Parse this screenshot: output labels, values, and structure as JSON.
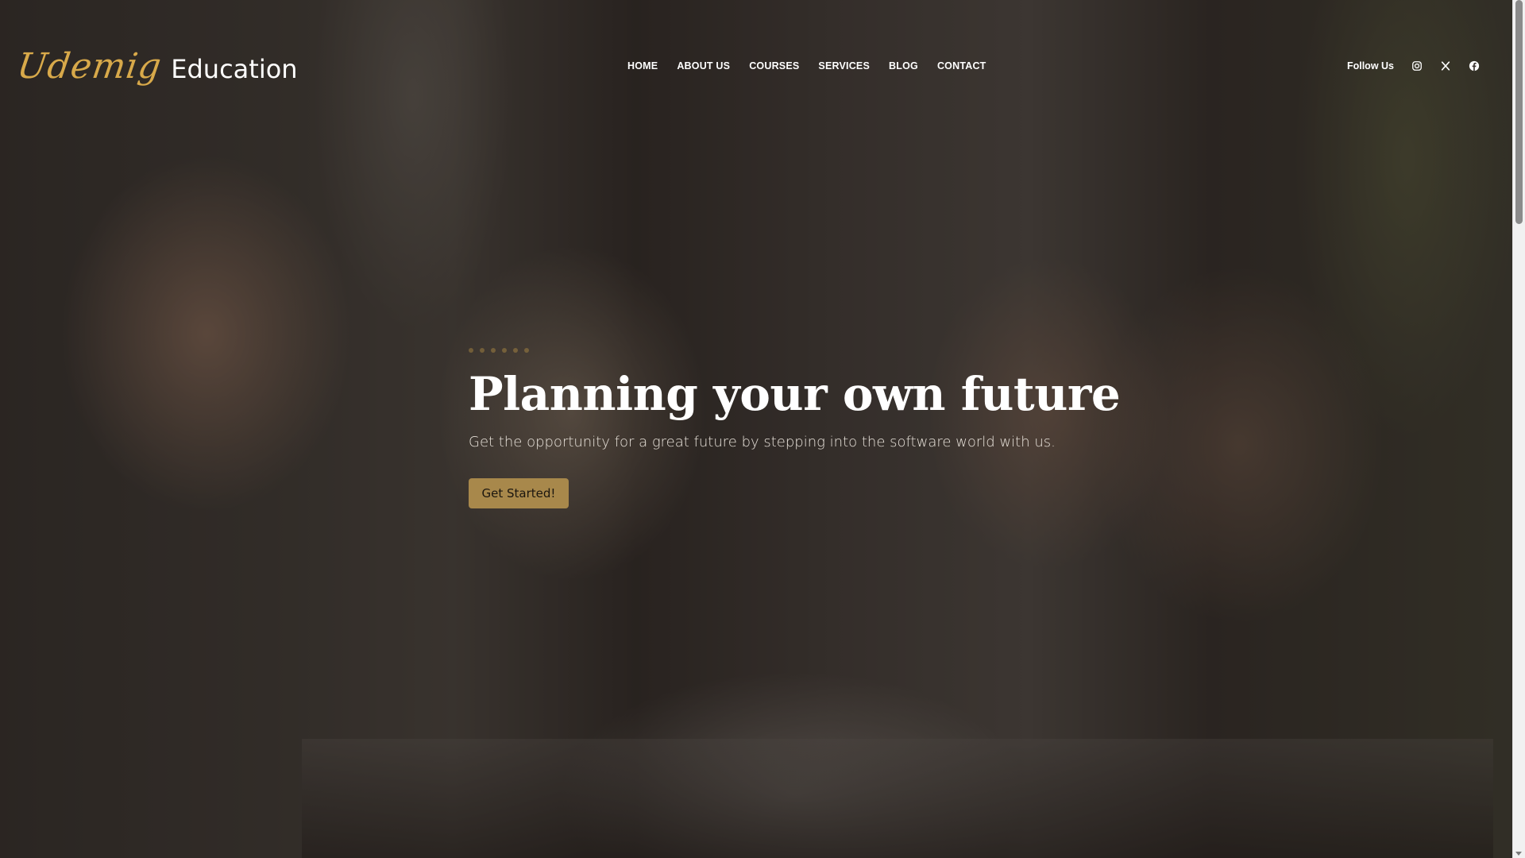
{
  "brand": {
    "script_name": "Udemig",
    "word": "Education",
    "accent_color": "#d8a94a"
  },
  "nav": {
    "items": [
      {
        "label": "HOME"
      },
      {
        "label": "ABOUT US"
      },
      {
        "label": "COURSES"
      },
      {
        "label": "SERVICES"
      },
      {
        "label": "BLOG"
      },
      {
        "label": "CONTACT"
      }
    ]
  },
  "social": {
    "label": "Follow Us",
    "icons": [
      "instagram-icon",
      "x-icon",
      "facebook-icon"
    ]
  },
  "hero": {
    "title": "Planning your own future",
    "subtitle": "Get the opportunity for a great future by stepping into the software world with us.",
    "cta_label": "Get Started!",
    "cta_color": "#a8884b",
    "background": "students-studying-photo"
  }
}
